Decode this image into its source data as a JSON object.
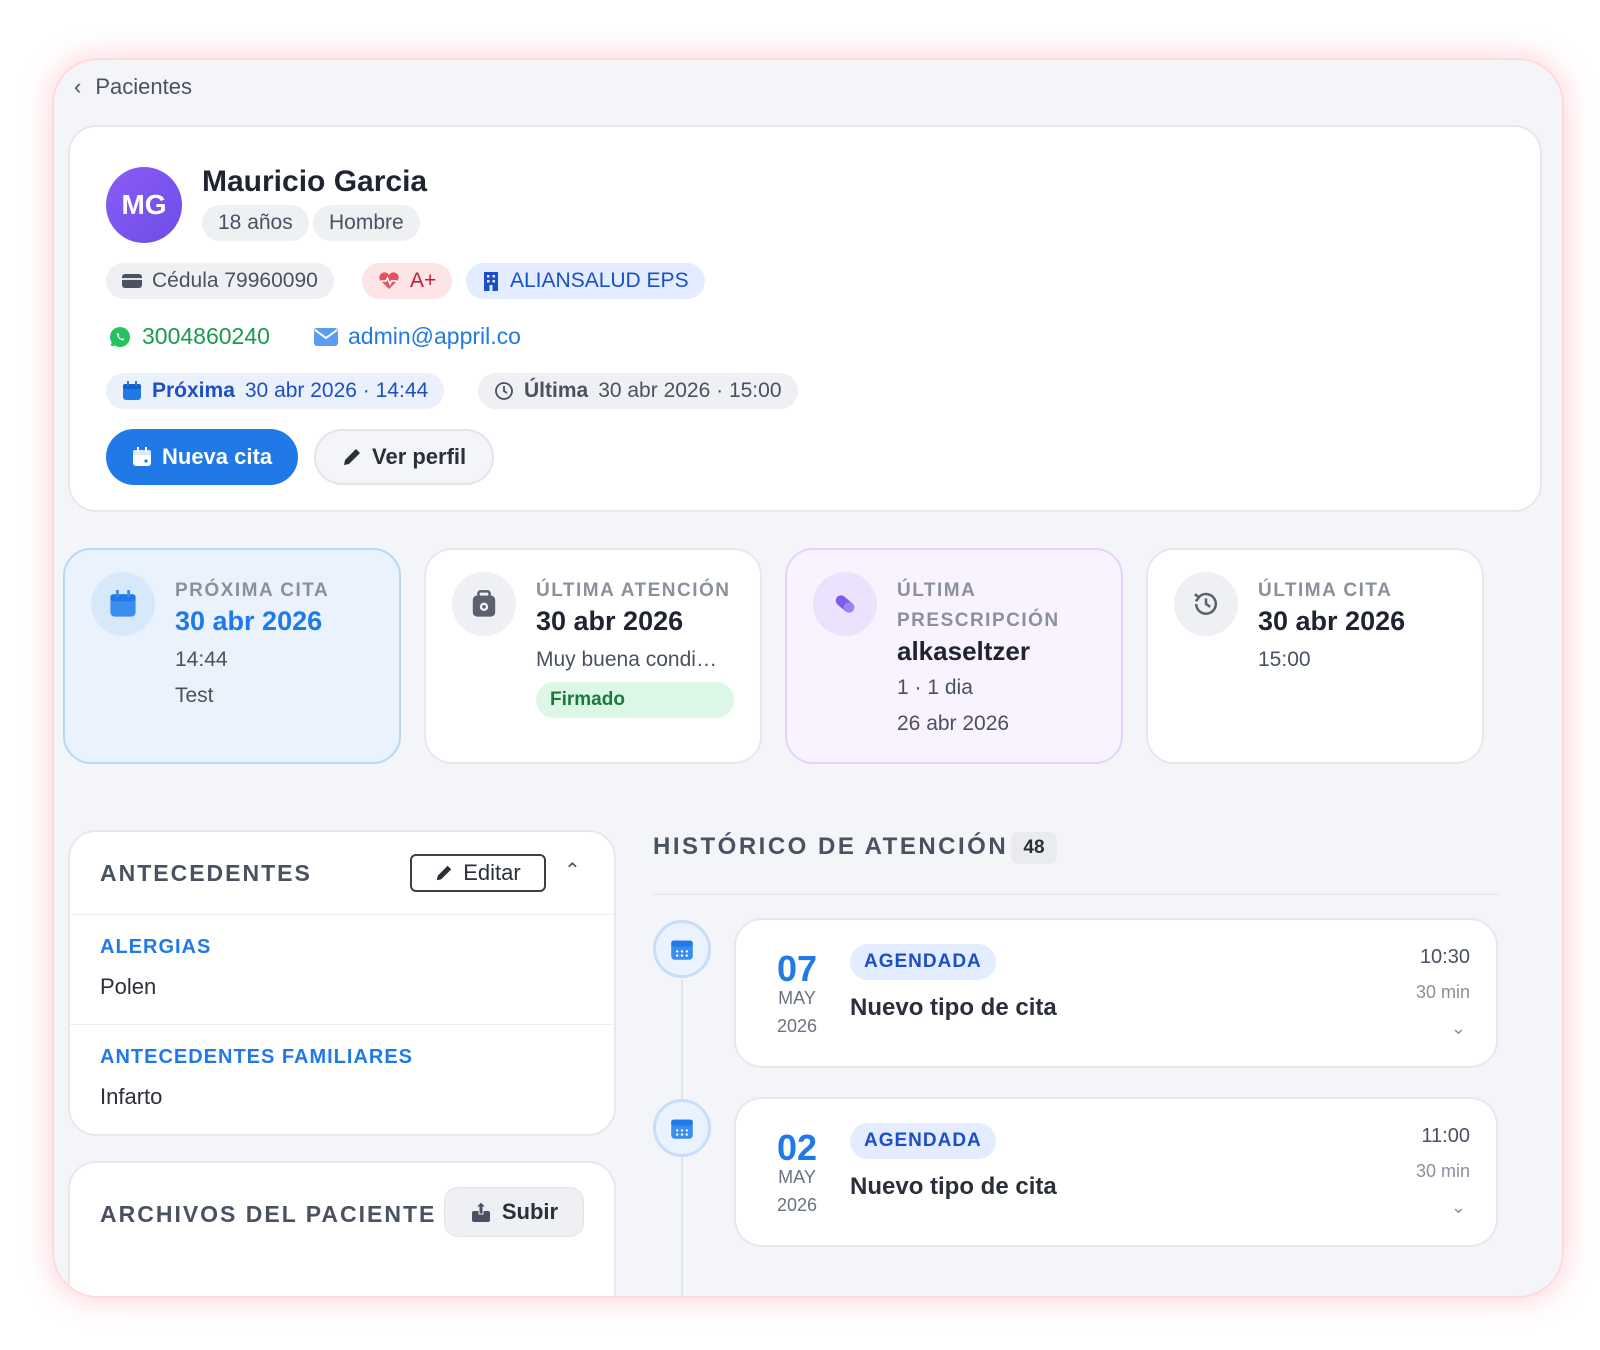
{
  "nav": {
    "back_label": "Pacientes"
  },
  "patient": {
    "initials": "MG",
    "name": "Mauricio Garcia",
    "age": "18 años",
    "sex": "Hombre",
    "id_label": "Cédula 79960090",
    "blood": "A+",
    "eps": "ALIANSALUD EPS",
    "phone": "3004860240",
    "email": "admin@appril.co",
    "next_label": "Próxima",
    "next_value": "30 abr 2026 · 14:44",
    "last_label": "Última",
    "last_value": "30 abr 2026 · 15:00"
  },
  "actions": {
    "new_appt": "Nueva cita",
    "view_profile": "Ver perfil"
  },
  "stats": {
    "next": {
      "label": "PRÓXIMA CITA",
      "date": "30 abr 2026",
      "time": "14:44",
      "note": "Test"
    },
    "attention": {
      "label": "ÚLTIMA ATENCIÓN",
      "date": "30 abr 2026",
      "note": "Muy buena condi…",
      "badge": "Firmado"
    },
    "prescription": {
      "label": "ÚLTIMA PRESCRIPCIÓN",
      "drug": "alkaseltzer",
      "dose": "1 · 1 dia",
      "date": "26 abr 2026"
    },
    "last": {
      "label": "ÚLTIMA CITA",
      "date": "30 abr 2026",
      "time": "15:00"
    }
  },
  "antecedentes": {
    "title": "ANTECEDENTES",
    "edit": "Editar",
    "allergies_label": "ALERGIAS",
    "allergies_value": "Polen",
    "family_label": "ANTECEDENTES FAMILIARES",
    "family_value": "Infarto"
  },
  "files": {
    "title": "ARCHIVOS DEL PACIENTE",
    "upload": "Subir"
  },
  "history": {
    "title": "HISTÓRICO DE ATENCIÓN",
    "count": "48",
    "items": [
      {
        "day": "07",
        "month": "MAY",
        "year": "2026",
        "status": "AGENDADA",
        "type": "Nuevo tipo de cita",
        "time": "10:30",
        "duration": "30 min"
      },
      {
        "day": "02",
        "month": "MAY",
        "year": "2026",
        "status": "AGENDADA",
        "type": "Nuevo tipo de cita",
        "time": "11:00",
        "duration": "30 min"
      }
    ]
  },
  "colors": {
    "accent": "#1f7ae8",
    "purple": "#7c5ce8",
    "green": "#1a9a4a",
    "red": "#c0202d"
  }
}
